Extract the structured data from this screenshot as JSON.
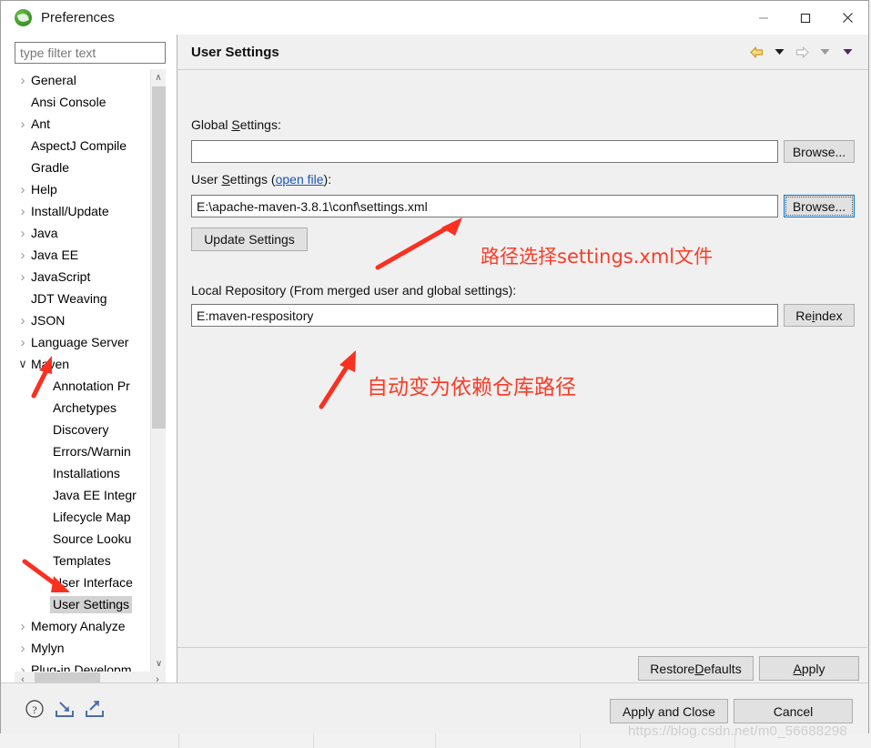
{
  "window": {
    "title": "Preferences",
    "icon": "eclipse-icon",
    "minimize_label": "Minimize",
    "maximize_label": "Maximize",
    "close_label": "Close"
  },
  "sidebar": {
    "filter_placeholder": "type filter text",
    "filter_value": "",
    "items": [
      {
        "label": "General",
        "expandable": true,
        "expanded": false,
        "indent": 0,
        "selected": false
      },
      {
        "label": "Ansi Console",
        "expandable": false,
        "expanded": false,
        "indent": 0,
        "selected": false
      },
      {
        "label": "Ant",
        "expandable": true,
        "expanded": false,
        "indent": 0,
        "selected": false
      },
      {
        "label": "AspectJ Compile",
        "expandable": false,
        "expanded": false,
        "indent": 0,
        "selected": false
      },
      {
        "label": "Gradle",
        "expandable": false,
        "expanded": false,
        "indent": 0,
        "selected": false
      },
      {
        "label": "Help",
        "expandable": true,
        "expanded": false,
        "indent": 0,
        "selected": false
      },
      {
        "label": "Install/Update",
        "expandable": true,
        "expanded": false,
        "indent": 0,
        "selected": false
      },
      {
        "label": "Java",
        "expandable": true,
        "expanded": false,
        "indent": 0,
        "selected": false
      },
      {
        "label": "Java EE",
        "expandable": true,
        "expanded": false,
        "indent": 0,
        "selected": false
      },
      {
        "label": "JavaScript",
        "expandable": true,
        "expanded": false,
        "indent": 0,
        "selected": false
      },
      {
        "label": "JDT Weaving",
        "expandable": false,
        "expanded": false,
        "indent": 0,
        "selected": false
      },
      {
        "label": "JSON",
        "expandable": true,
        "expanded": false,
        "indent": 0,
        "selected": false
      },
      {
        "label": "Language Server",
        "expandable": true,
        "expanded": false,
        "indent": 0,
        "selected": false
      },
      {
        "label": "Maven",
        "expandable": true,
        "expanded": true,
        "indent": 0,
        "selected": false
      },
      {
        "label": "Annotation Pr",
        "expandable": false,
        "expanded": false,
        "indent": 1,
        "selected": false
      },
      {
        "label": "Archetypes",
        "expandable": false,
        "expanded": false,
        "indent": 1,
        "selected": false
      },
      {
        "label": "Discovery",
        "expandable": false,
        "expanded": false,
        "indent": 1,
        "selected": false
      },
      {
        "label": "Errors/Warnin",
        "expandable": false,
        "expanded": false,
        "indent": 1,
        "selected": false
      },
      {
        "label": "Installations",
        "expandable": false,
        "expanded": false,
        "indent": 1,
        "selected": false
      },
      {
        "label": "Java EE Integr",
        "expandable": false,
        "expanded": false,
        "indent": 1,
        "selected": false
      },
      {
        "label": "Lifecycle Map",
        "expandable": false,
        "expanded": false,
        "indent": 1,
        "selected": false
      },
      {
        "label": "Source Looku",
        "expandable": false,
        "expanded": false,
        "indent": 1,
        "selected": false
      },
      {
        "label": "Templates",
        "expandable": false,
        "expanded": false,
        "indent": 1,
        "selected": false
      },
      {
        "label": "User Interface",
        "expandable": false,
        "expanded": false,
        "indent": 1,
        "selected": false
      },
      {
        "label": "User Settings",
        "expandable": false,
        "expanded": false,
        "indent": 1,
        "selected": true
      },
      {
        "label": "Memory Analyze",
        "expandable": true,
        "expanded": false,
        "indent": 0,
        "selected": false
      },
      {
        "label": "Mylyn",
        "expandable": true,
        "expanded": false,
        "indent": 0,
        "selected": false
      },
      {
        "label": "Plug-in Developm",
        "expandable": true,
        "expanded": false,
        "indent": 0,
        "selected": false
      }
    ],
    "chevron_collapsed": "›",
    "chevron_expanded": "∨",
    "scroll_up": "∧",
    "scroll_down": "∨",
    "scroll_left": "‹",
    "scroll_right": "›"
  },
  "page": {
    "title": "User Settings",
    "nav": {
      "back_label": "Back",
      "back_menu_label": "Back history",
      "forward_label": "Forward",
      "forward_menu_label": "Forward history",
      "view_menu_label": "View menu",
      "back_color": "#e0a516",
      "forward_color": "#b8b8b8",
      "menu_color": "#5a1f6e"
    },
    "global_settings": {
      "label_pre": "Global ",
      "label_mnemonic": "S",
      "label_post": "ettings:",
      "value": "",
      "browse_label": "Browse..."
    },
    "user_settings": {
      "label_pre": "User ",
      "label_mnemonic": "S",
      "label_mid": "ettings (",
      "link_text": "open file",
      "label_post": "):",
      "value": "E:\\apache-maven-3.8.1\\conf\\settings.xml",
      "browse_label": "Browse...",
      "update_label": "Update Settings"
    },
    "local_repository": {
      "label": "Local Repository (From merged user and global settings):",
      "value": "E:maven-respository",
      "reindex_pre": "Re",
      "reindex_mnemonic": "i",
      "reindex_post": "ndex"
    },
    "buttons": {
      "restore_defaults_pre": "Restore ",
      "restore_defaults_mnemonic": "D",
      "restore_defaults_post": "efaults",
      "apply_mnemonic": "A",
      "apply_post": "pply"
    }
  },
  "footer": {
    "apply_and_close": "Apply and Close",
    "cancel": "Cancel",
    "help_icon_label": "Help",
    "import_icon_label": "Import preferences",
    "export_icon_label": "Export preferences"
  },
  "annotations": [
    {
      "text": "路径选择settings.xml文件",
      "color": "#fa3c28"
    },
    {
      "text": "自动变为依赖仓库路径",
      "color": "#fa3c28"
    }
  ],
  "watermark": "https://blog.csdn.net/m0_56688298"
}
